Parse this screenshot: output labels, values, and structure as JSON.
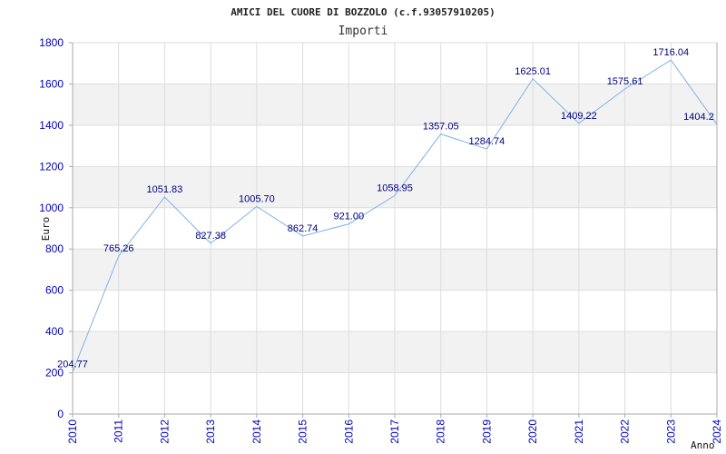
{
  "chart_data": {
    "type": "line",
    "title": "AMICI DEL CUORE DI BOZZOLO (c.f.93057910205)",
    "subtitle": "Importi",
    "xlabel": "Anno",
    "ylabel": "Euro",
    "ylim": [
      0,
      1800
    ],
    "y_ticks": [
      0,
      200,
      400,
      600,
      800,
      1000,
      1200,
      1400,
      1600,
      1800
    ],
    "grid": true,
    "categories": [
      "2010",
      "2011",
      "2012",
      "2013",
      "2014",
      "2015",
      "2016",
      "2017",
      "2018",
      "2019",
      "2020",
      "2021",
      "2022",
      "2023",
      "2024"
    ],
    "series": [
      {
        "values": [
          204.77,
          765.26,
          1051.83,
          827.38,
          1005.7,
          862.74,
          921.0,
          1058.95,
          1357.05,
          1284.74,
          1625.01,
          1409.22,
          1575.61,
          1716.04,
          1404.2
        ],
        "labels": [
          "204.77",
          "765.26",
          "1051.83",
          "827.38",
          "1005.70",
          "862.74",
          "921.00",
          "1058.95",
          "1357.05",
          "1284.74",
          "1625.01",
          "1409.22",
          "1575.61",
          "1716.04",
          "1404.2"
        ],
        "color": "#7fb2e5"
      }
    ],
    "colors": {
      "band": "#f2f2f2",
      "grid": "#dddddd",
      "axis": "#aaaaaa",
      "tick_text": "#0000bb",
      "label_text": "#000080"
    }
  }
}
